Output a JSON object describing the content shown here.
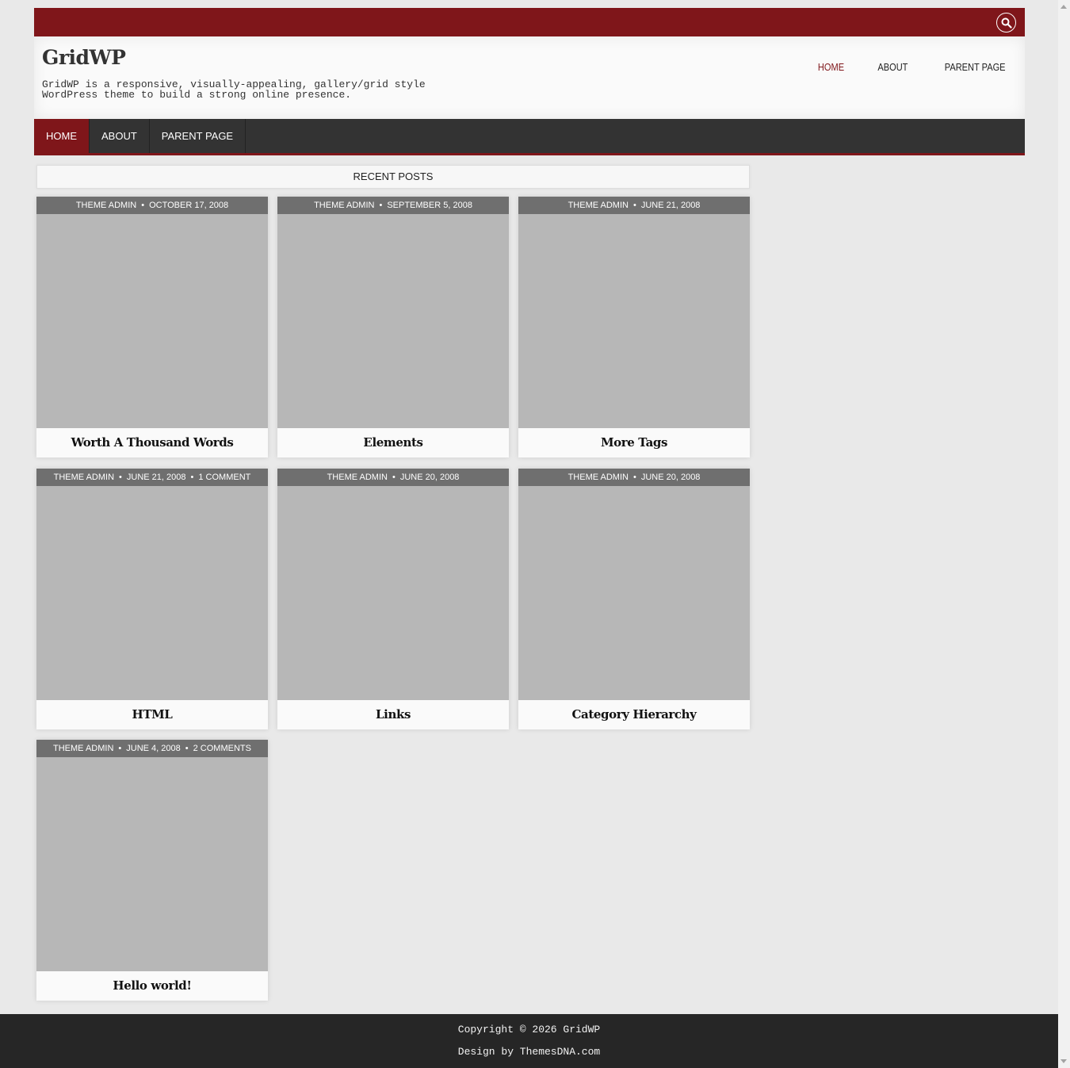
{
  "site": {
    "title": "GridWP",
    "description": "GridWP is a responsive, visually-appealing, gallery/grid style WordPress theme to build a strong online presence."
  },
  "header_nav": [
    {
      "label": "HOME",
      "active": true
    },
    {
      "label": "ABOUT",
      "active": false
    },
    {
      "label": "PARENT PAGE",
      "active": false
    }
  ],
  "main_nav": [
    {
      "label": "HOME",
      "active": true
    },
    {
      "label": "ABOUT",
      "active": false
    },
    {
      "label": "PARENT PAGE",
      "active": false
    }
  ],
  "section_title": "RECENT POSTS",
  "posts": [
    {
      "author": "THEME ADMIN",
      "date": "OCTOBER 17, 2008",
      "comments": "",
      "title": "Worth A Thousand Words"
    },
    {
      "author": "THEME ADMIN",
      "date": "SEPTEMBER 5, 2008",
      "comments": "",
      "title": "Elements"
    },
    {
      "author": "THEME ADMIN",
      "date": "JUNE 21, 2008",
      "comments": "",
      "title": "More Tags"
    },
    {
      "author": "THEME ADMIN",
      "date": "JUNE 21, 2008",
      "comments": "1 COMMENT",
      "title": "HTML"
    },
    {
      "author": "THEME ADMIN",
      "date": "JUNE 20, 2008",
      "comments": "",
      "title": "Links"
    },
    {
      "author": "THEME ADMIN",
      "date": "JUNE 20, 2008",
      "comments": "",
      "title": "Category Hierarchy"
    },
    {
      "author": "THEME ADMIN",
      "date": "JUNE 4, 2008",
      "comments": "2 COMMENTS",
      "title": "Hello world!"
    }
  ],
  "footer": {
    "copyright": "Copyright © 2026 GridWP",
    "credit": "Design by ThemesDNA.com"
  },
  "colors": {
    "accent": "#7f161a",
    "nav_bg": "#333333",
    "meta_bg": "#6f6f6f",
    "thumb_placeholder": "#b7b7b7"
  },
  "icons": {
    "search": "search-icon"
  }
}
